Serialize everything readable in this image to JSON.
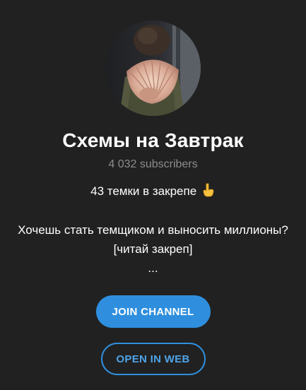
{
  "channel": {
    "name": "Схемы на Завтрак",
    "subscribers": "4 032 subscribers",
    "avatar_alt": "channel-avatar-photo"
  },
  "description": {
    "line1_text": "43 темки в закрепе",
    "line1_emoji": "backhand-index-pointing-down-icon",
    "line2": "Хочешь стать темщиком и выносить миллионы?",
    "line3": "[читай закреп]",
    "line4": "..."
  },
  "buttons": {
    "join_label": "JOIN CHANNEL",
    "open_web_label": "OPEN IN WEB"
  },
  "colors": {
    "background": "#212121",
    "accent": "#2f8fde",
    "text_primary": "#ffffff",
    "text_secondary": "#8d8d8d"
  }
}
